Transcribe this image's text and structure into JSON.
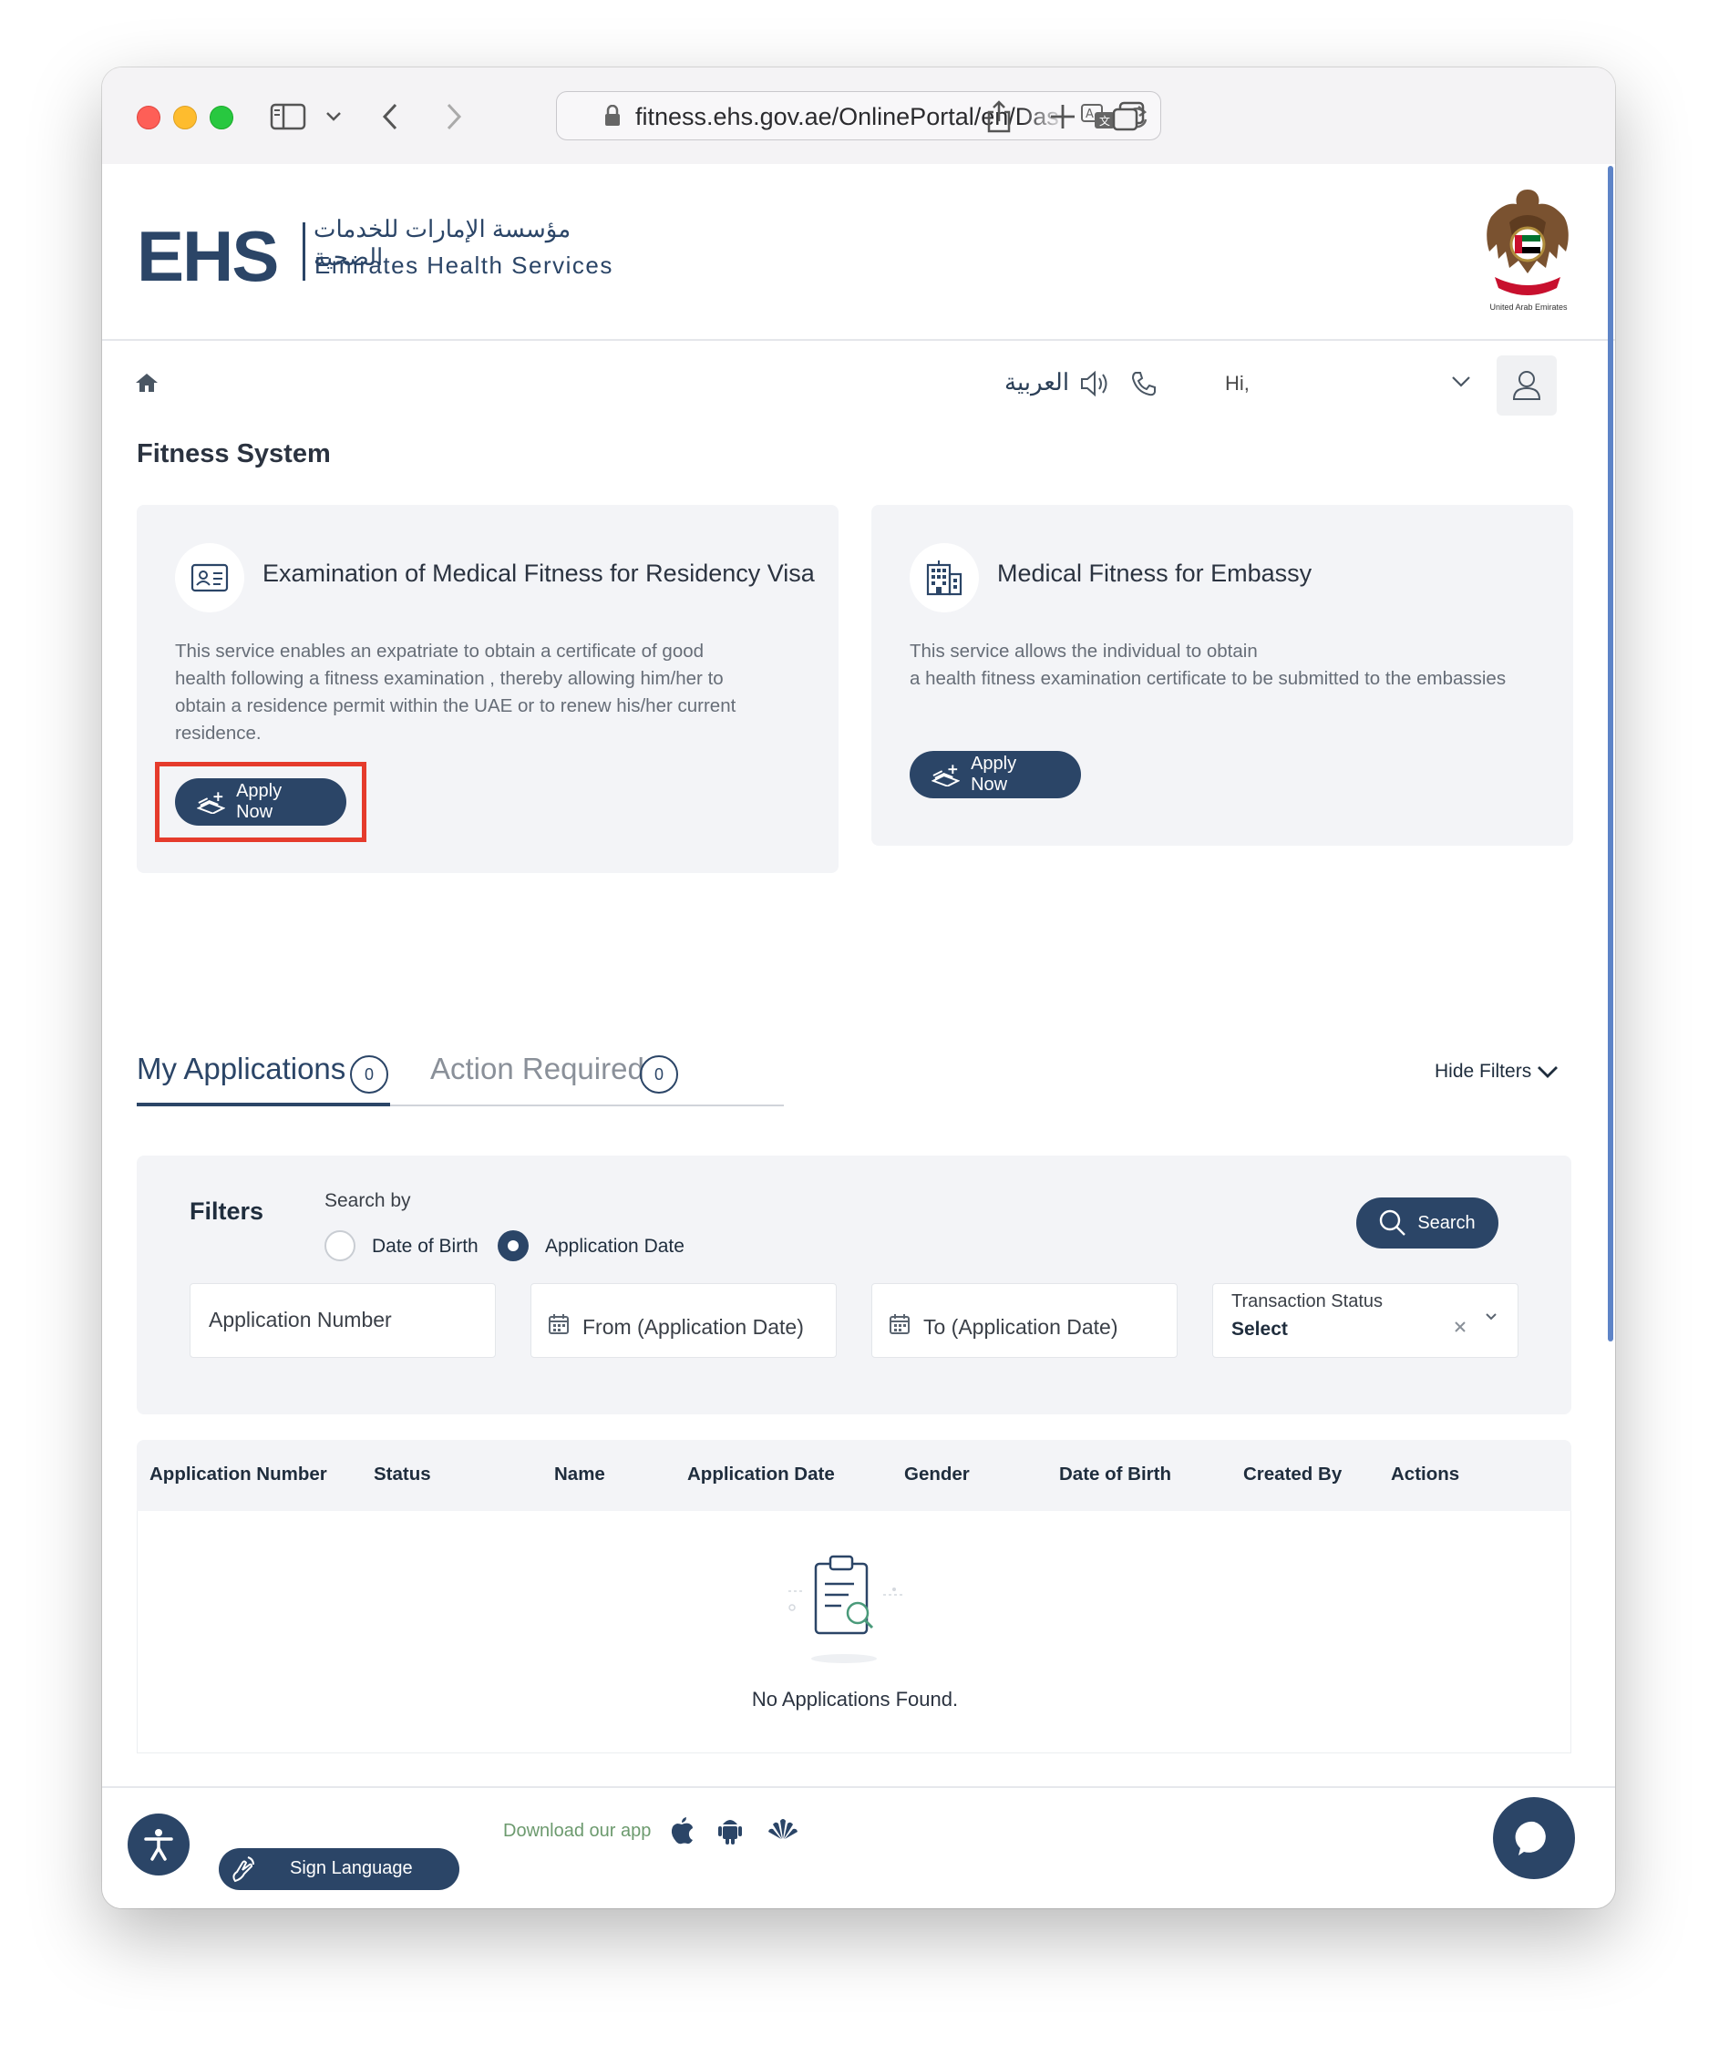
{
  "browser": {
    "url": "fitness.ehs.gov.ae/OnlinePortal/en/Das"
  },
  "header": {
    "logo_text": "EHS",
    "logo_arabic": "مؤسسة الإمارات للخدمات الصحية",
    "logo_english": "Emirates Health Services",
    "emblem_caption": "United Arab Emirates"
  },
  "nav": {
    "language": "العربية",
    "greeting": "Hi,"
  },
  "page": {
    "title": "Fitness System"
  },
  "services": [
    {
      "title": "Examination of Medical Fitness for Residency Visa",
      "description_lines": [
        "This service enables an expatriate to obtain a certificate of good",
        "health following a fitness examination , thereby allowing him/her to",
        "obtain a residence permit within the UAE or to renew his/her current",
        "residence."
      ],
      "button": "Apply Now"
    },
    {
      "title": "Medical Fitness for Embassy",
      "description_lines": [
        "This service allows the individual to obtain",
        "a health fitness examination certificate to be submitted to the embassies"
      ],
      "button": "Apply Now"
    }
  ],
  "tabs": [
    {
      "label": "My Applications",
      "count": "0",
      "active": true
    },
    {
      "label": "Action Required",
      "count": "0",
      "active": false
    }
  ],
  "hide_filters": "Hide Filters",
  "filters": {
    "title": "Filters",
    "search_by": "Search by",
    "options": [
      {
        "label": "Date of Birth",
        "selected": false
      },
      {
        "label": "Application Date",
        "selected": true
      }
    ],
    "search_button": "Search",
    "application_number_placeholder": "Application Number",
    "from_placeholder": "From (Application Date)",
    "to_placeholder": "To (Application Date)",
    "status_label": "Transaction Status",
    "status_value": "Select"
  },
  "table": {
    "columns": [
      "Application Number",
      "Status",
      "Name",
      "Application Date",
      "Gender",
      "Date of Birth",
      "Created By",
      "Actions"
    ],
    "empty_message": "No Applications Found."
  },
  "footer": {
    "sign_language": "Sign Language",
    "download_app": "Download our app"
  },
  "colors": {
    "primary": "#2b4567",
    "highlight": "#e53b2c",
    "card_bg": "#f3f4f7"
  }
}
